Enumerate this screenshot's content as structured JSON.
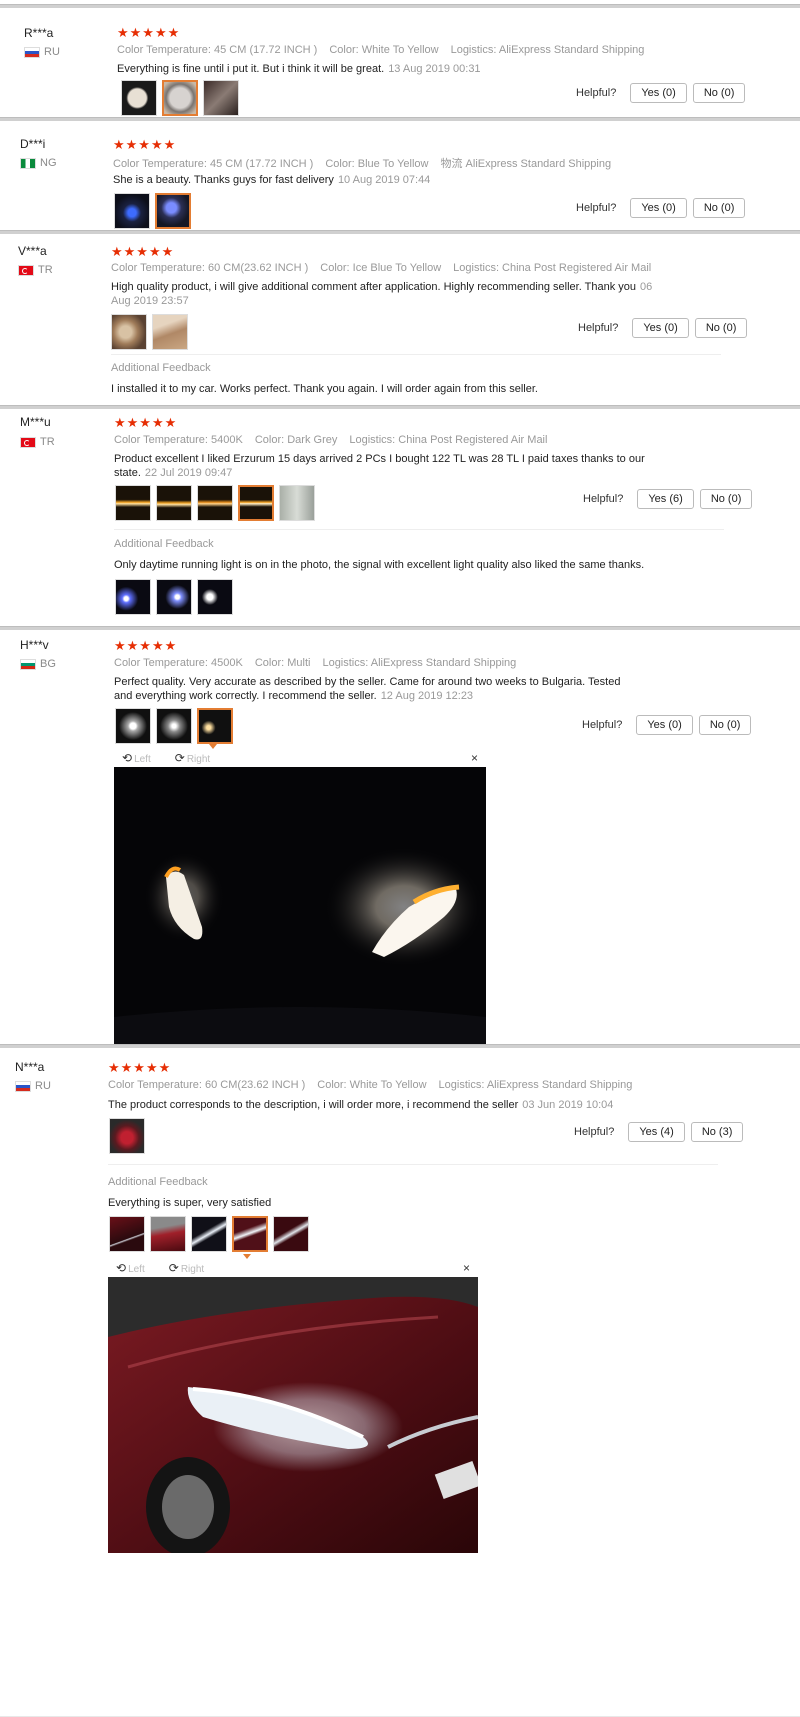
{
  "helpful_label": "Helpful?",
  "additional_label": "Additional Feedback",
  "viewer": {
    "left": "Left",
    "right": "Right",
    "close": "×"
  },
  "reviews": [
    {
      "name": "R***a",
      "country": "RU",
      "stars": "★★★★★",
      "attrs": [
        "Color Temperature: 45 CM (17.72 INCH )",
        "Color: White To Yellow",
        "Logistics: AliExpress Standard Shipping"
      ],
      "text": "Everything is fine until i put it. But i think it will be great.",
      "date": "13 Aug 2019 00:31",
      "yes": "Yes (0)",
      "no": "No (0)"
    },
    {
      "name": "D***i",
      "country": "NG",
      "stars": "★★★★★",
      "attrs": [
        "Color Temperature: 45 CM (17.72 INCH )",
        "Color: Blue To Yellow",
        "物流 AliExpress Standard Shipping"
      ],
      "text": "She is a beauty. Thanks guys for fast delivery",
      "date": "10 Aug 2019 07:44",
      "yes": "Yes (0)",
      "no": "No (0)"
    },
    {
      "name": "V***a",
      "country": "TR",
      "stars": "★★★★★",
      "attrs": [
        "Color Temperature: 60 CM(23.62 INCH )",
        "Color: Ice Blue To Yellow",
        "Logistics: China Post Registered Air Mail"
      ],
      "text": "High quality product, i will give additional comment after application. Highly recommending seller. Thank you",
      "date": "06 Aug 2019 23:57",
      "yes": "Yes (0)",
      "no": "No (0)",
      "additional": "I installed it to my car. Works perfect. Thank you again. I will order again from this seller."
    },
    {
      "name": "M***u",
      "country": "TR",
      "stars": "★★★★★",
      "attrs": [
        "Color Temperature: 5400K",
        "Color: Dark Grey",
        "Logistics: China Post Registered Air Mail"
      ],
      "text": "Product excellent I liked Erzurum 15 days arrived 2 PCs I bought 122 TL was 28 TL I paid taxes thanks to our state.",
      "date": "22 Jul 2019 09:47",
      "yes": "Yes (6)",
      "no": "No (0)",
      "additional": "Only daytime running light is on in the photo, the signal with excellent light quality also liked the same thanks."
    },
    {
      "name": "H***v",
      "country": "BG",
      "stars": "★★★★★",
      "attrs": [
        "Color Temperature: 4500K",
        "Color: Multi",
        "Logistics: AliExpress Standard Shipping"
      ],
      "text": "Perfect quality. Very accurate as described by the seller. Came for around two weeks to Bulgaria. Tested and everything work correctly. I recommend the seller.",
      "date": "12 Aug 2019 12:23",
      "yes": "Yes (0)",
      "no": "No (0)"
    },
    {
      "name": "N***a",
      "country": "RU",
      "stars": "★★★★★",
      "attrs": [
        "Color Temperature: 60 CM(23.62 INCH )",
        "Color: White To Yellow",
        "Logistics: AliExpress Standard Shipping"
      ],
      "text": "The product corresponds to the description, i will order more, i recommend the seller",
      "date": "03 Jun 2019 10:04",
      "yes": "Yes (4)",
      "no": "No (3)",
      "additional": "Everything is super, very satisfied"
    }
  ]
}
